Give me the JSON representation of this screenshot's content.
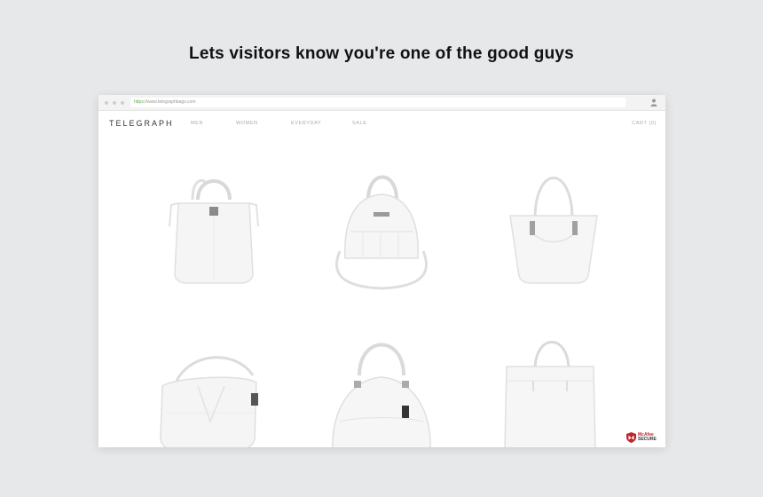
{
  "headline": "Lets visitors know you're one of the good guys",
  "browser": {
    "url_protocol": "https://",
    "url_rest": "www.telegraphbags.com"
  },
  "site": {
    "brand": "TELEGRAPH",
    "nav": [
      "MEN",
      "WOMEN",
      "EVERYDAY",
      "SALE"
    ],
    "cart": "CART (0)"
  },
  "products": [
    {
      "icon": "white-tote-bag"
    },
    {
      "icon": "white-dome-satchel"
    },
    {
      "icon": "white-shoulder-tote"
    },
    {
      "icon": "white-hobo-bag"
    },
    {
      "icon": "white-bowling-bag"
    },
    {
      "icon": "white-square-tote"
    }
  ],
  "badge": {
    "line1": "McAfee",
    "line2": "SECURE",
    "accent": "#c0262c"
  }
}
